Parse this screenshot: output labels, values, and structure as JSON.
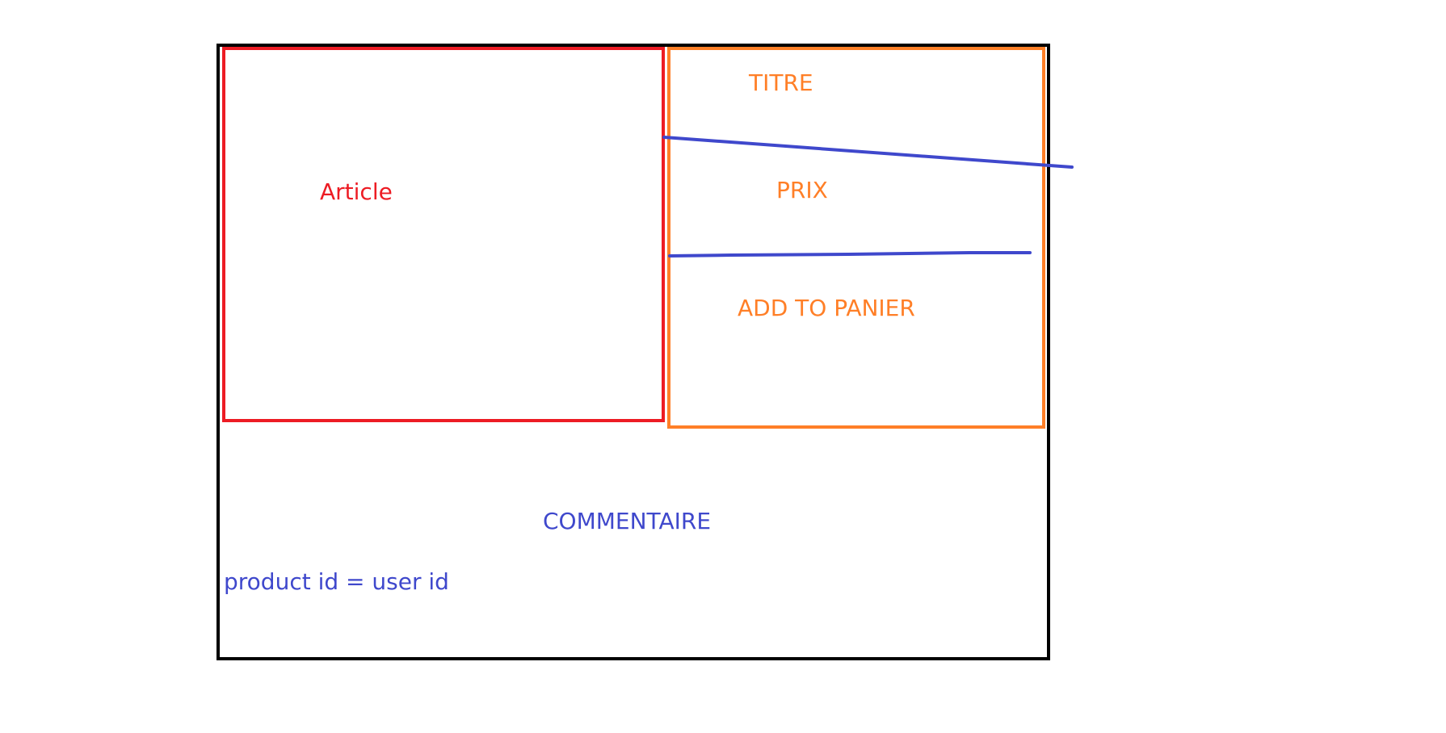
{
  "colors": {
    "frame": "#000000",
    "article": "#ed1c24",
    "details": "#ff7f27",
    "comments": "#3f48cc"
  },
  "article": {
    "label": "Article"
  },
  "details": {
    "title_label": "TITRE",
    "price_label": "PRIX",
    "add_to_cart_label": "ADD TO PANIER"
  },
  "comments": {
    "label": "COMMENTAIRE",
    "note": "product id = user id"
  }
}
